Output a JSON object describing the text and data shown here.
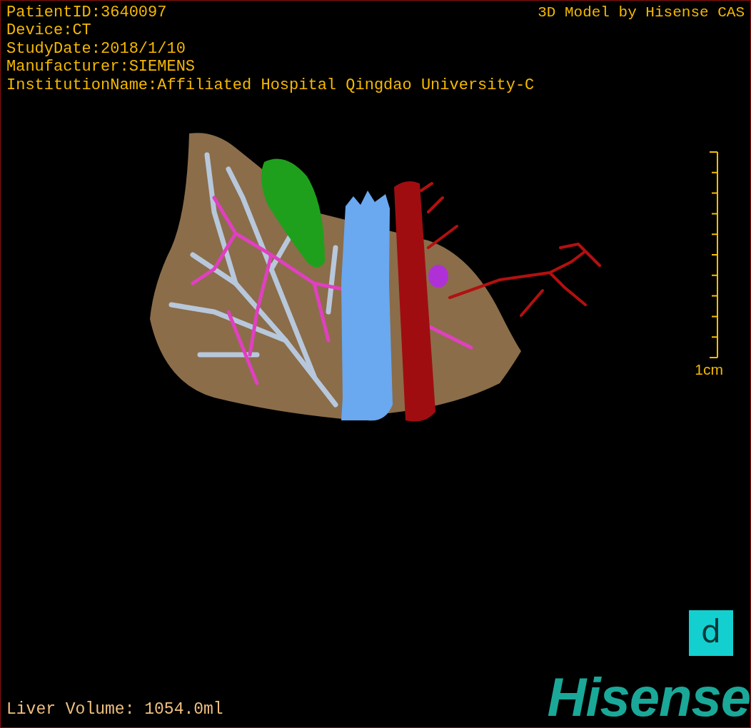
{
  "info_lines": [
    "PatientID:3640097",
    "Device:CT",
    "StudyDate:2018/1/10",
    "Manufacturer:SIEMENS",
    "InstitutionName:Affiliated Hospital Qingdao University-C"
  ],
  "title": "3D Model by Hisense CAS",
  "scale_label": "1cm",
  "volume": "Liver Volume: 1054.0ml",
  "badge": "d",
  "logo": "Hisense"
}
